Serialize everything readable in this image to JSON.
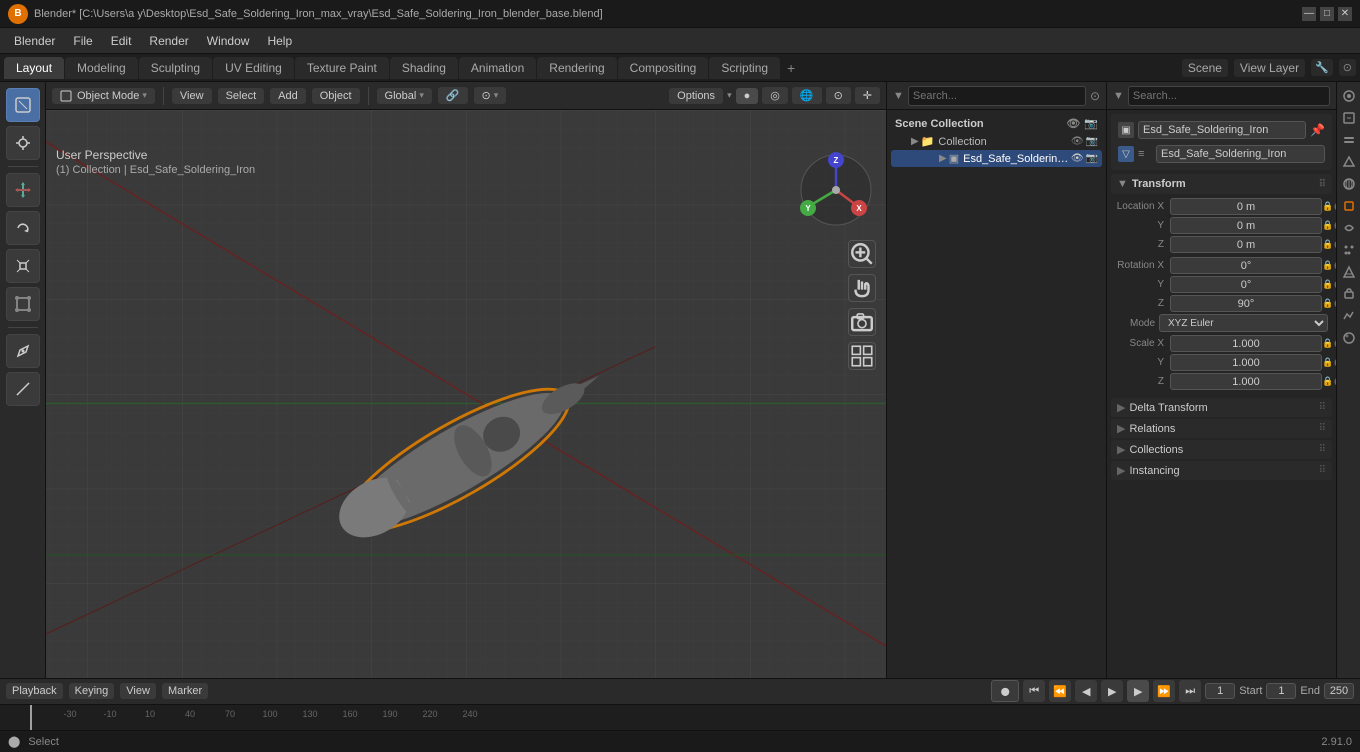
{
  "titlebar": {
    "title": "Blender* [C:\\Users\\a y\\Desktop\\Esd_Safe_Soldering_Iron_max_vray\\Esd_Safe_Soldering_Iron_blender_base.blend]",
    "controls": [
      "—",
      "□",
      "✕"
    ]
  },
  "menubar": {
    "items": [
      "Blender",
      "File",
      "Edit",
      "Render",
      "Window",
      "Help"
    ]
  },
  "workspace_tabs": {
    "tabs": [
      "Layout",
      "Modeling",
      "Sculpting",
      "UV Editing",
      "Texture Paint",
      "Shading",
      "Animation",
      "Rendering",
      "Compositing",
      "Scripting"
    ],
    "active": "Layout",
    "add_label": "+",
    "right": {
      "scene_label": "Scene",
      "view_layer_label": "View Layer"
    }
  },
  "viewport_header": {
    "mode": "Object Mode",
    "view_label": "View",
    "select_label": "Select",
    "add_label": "Add",
    "object_label": "Object",
    "global_label": "Global",
    "options_label": "Options"
  },
  "viewport_info": {
    "perspective": "User Perspective",
    "collection": "(1) Collection | Esd_Safe_Soldering_Iron"
  },
  "left_toolbar": {
    "tools": [
      {
        "name": "select-cursor",
        "icon": "⊕",
        "active": false
      },
      {
        "name": "move-tool",
        "icon": "✛",
        "active": false
      },
      {
        "name": "rotate-tool",
        "icon": "↻",
        "active": false
      },
      {
        "name": "scale-tool",
        "icon": "⤢",
        "active": false
      },
      {
        "name": "transform-tool",
        "icon": "⊞",
        "active": false
      },
      {
        "name": "annotate-tool",
        "icon": "✏",
        "active": false
      },
      {
        "name": "measure-tool",
        "icon": "⊿",
        "active": false
      }
    ]
  },
  "properties_header": {
    "scene_collection_label": "Scene Collection"
  },
  "outliner": {
    "collection_label": "Collection",
    "items": [
      {
        "name": "Esd_Safe_Soldering_I",
        "level": 1,
        "selected": true,
        "active": true
      }
    ]
  },
  "object_properties": {
    "object_name": "Esd_Safe_Soldering_Iron",
    "data_name": "Esd_Safe_Soldering_Iron",
    "transform": {
      "label": "Transform",
      "location": {
        "x": "0 m",
        "y": "0 m",
        "z": "0 m"
      },
      "rotation": {
        "x": "0°",
        "y": "0°",
        "z": "90°"
      },
      "rotation_mode": "XYZ Euler",
      "scale": {
        "x": "1.000",
        "y": "1.000",
        "z": "1.000"
      }
    },
    "delta_transform_label": "Delta Transform",
    "relations_label": "Relations",
    "collections_label": "Collections",
    "instancing_label": "Instancing"
  },
  "timeline": {
    "playback_label": "Playback",
    "keying_label": "Keying",
    "view_label": "View",
    "marker_label": "Marker",
    "current_frame": "1",
    "start_label": "Start",
    "start_frame": "1",
    "end_label": "End",
    "end_frame": "250"
  },
  "statusbar": {
    "left": "Select",
    "version": "2.91.0"
  },
  "colors": {
    "active_tab": "#3c3c3c",
    "accent_blue": "#4a6fa5",
    "accent_orange": "#e07000",
    "selected_highlight": "#e08000",
    "bg_dark": "#1a1a1a",
    "bg_medium": "#252525",
    "bg_light": "#2a2a2a",
    "bg_panel": "#3a3a3a"
  }
}
